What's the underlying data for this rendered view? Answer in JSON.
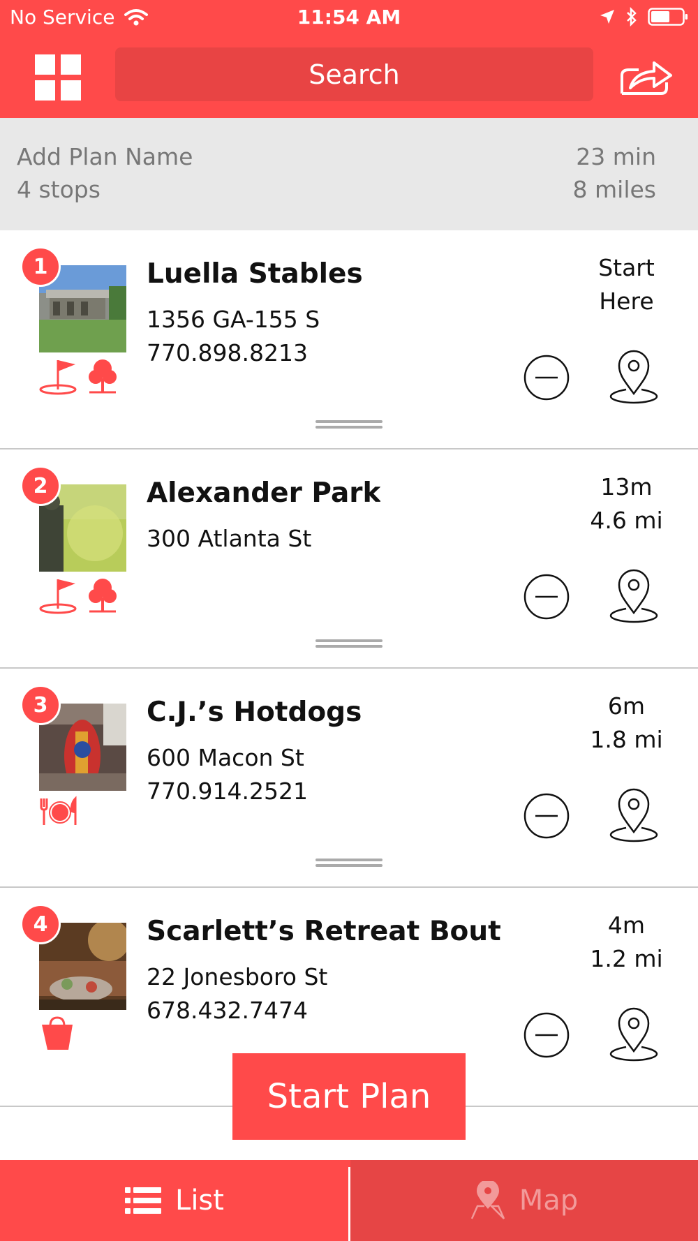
{
  "status_bar": {
    "carrier": "No Service",
    "time": "11:54 AM"
  },
  "header": {
    "search_label": "Search"
  },
  "plan": {
    "name_placeholder": "Add Plan Name",
    "stops": "4 stops",
    "duration": "23 min",
    "distance": "8 miles"
  },
  "stops": [
    {
      "number": "1",
      "name": "Luella Stables",
      "address": "1356 GA-155 S",
      "phone": "770.898.8213",
      "eta_line1": "Start",
      "eta_line2": "Here",
      "categories": [
        "golf-flag-icon",
        "tree-icon"
      ]
    },
    {
      "number": "2",
      "name": "Alexander Park",
      "address": "300 Atlanta St",
      "phone": "",
      "eta_line1": "13m",
      "eta_line2": "4.6 mi",
      "categories": [
        "golf-flag-icon",
        "tree-icon"
      ]
    },
    {
      "number": "3",
      "name": "C.J.’s Hotdogs",
      "address": "600 Macon St",
      "phone": "770.914.2521",
      "eta_line1": "6m",
      "eta_line2": "1.8 mi",
      "categories": [
        "dining-icon"
      ]
    },
    {
      "number": "4",
      "name": "Scarlett’s Retreat Boutiq...",
      "address": "22 Jonesboro St",
      "phone": "678.432.7474",
      "eta_line1": "4m",
      "eta_line2": "1.2 mi",
      "categories": [
        "shopping-bag-icon"
      ]
    }
  ],
  "actions": {
    "start_plan": "Start Plan"
  },
  "tabs": {
    "list": "List",
    "map": "Map"
  },
  "colors": {
    "accent": "#ff4a4a",
    "accent_dark": "#e64545",
    "summary_bg": "#e8e8e8"
  }
}
